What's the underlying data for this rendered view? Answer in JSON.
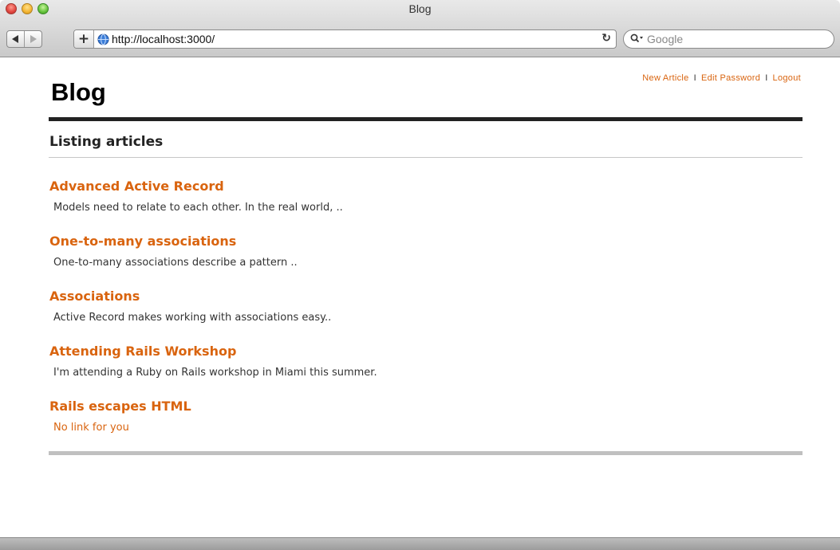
{
  "window": {
    "title": "Blog"
  },
  "toolbar": {
    "back_icon": "back-arrow-icon",
    "forward_icon": "forward-arrow-icon",
    "add_icon": "plus-icon",
    "url": "http://localhost:3000/",
    "search_placeholder": "Google"
  },
  "site": {
    "title": "Blog",
    "nav": [
      {
        "label": "New Article"
      },
      {
        "label": "Edit Password"
      },
      {
        "label": "Logout"
      }
    ],
    "nav_separator": "I"
  },
  "main": {
    "heading": "Listing articles",
    "articles": [
      {
        "title": "Advanced Active Record",
        "excerpt": "Models need to relate to each other. In the real world, .."
      },
      {
        "title": "One-to-many associations",
        "excerpt": "One-to-many associations describe a pattern .."
      },
      {
        "title": "Associations",
        "excerpt": "Active Record makes working with associations easy.."
      },
      {
        "title": "Attending Rails Workshop",
        "excerpt": "I'm attending a Ruby on Rails workshop in Miami this summer."
      },
      {
        "title": "Rails escapes HTML",
        "excerpt": "No link for you"
      }
    ]
  },
  "colors": {
    "link": "#d9640f",
    "header_rule": "#222222",
    "footer_rule": "#c0c0c0"
  }
}
